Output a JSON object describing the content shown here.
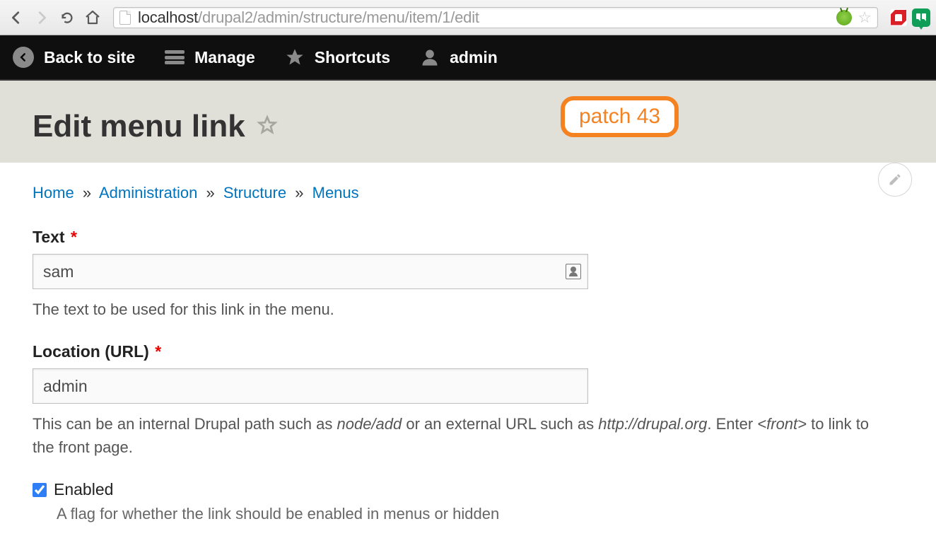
{
  "browser": {
    "url_host": "localhost",
    "url_path": "/drupal2/admin/structure/menu/item/1/edit"
  },
  "toolbar": {
    "back_to_site": "Back to site",
    "manage": "Manage",
    "shortcuts": "Shortcuts",
    "admin": "admin"
  },
  "header": {
    "title": "Edit menu link",
    "badge": "patch 43"
  },
  "breadcrumb": {
    "home": "Home",
    "administration": "Administration",
    "structure": "Structure",
    "menus": "Menus",
    "sep": "»"
  },
  "form": {
    "text": {
      "label": "Text",
      "value": "sam",
      "description": "The text to be used for this link in the menu."
    },
    "location": {
      "label": "Location (URL)",
      "value": "admin",
      "description_pre": "This can be an internal Drupal path such as ",
      "description_em1": "node/add",
      "description_mid": " or an external URL such as ",
      "description_em2": "http://drupal.org",
      "description_post1": ". Enter ",
      "description_em3": "<front>",
      "description_post2": " to link to the front page."
    },
    "enabled": {
      "label": "Enabled",
      "checked": true,
      "description": "A flag for whether the link should be enabled in menus or hidden"
    }
  }
}
